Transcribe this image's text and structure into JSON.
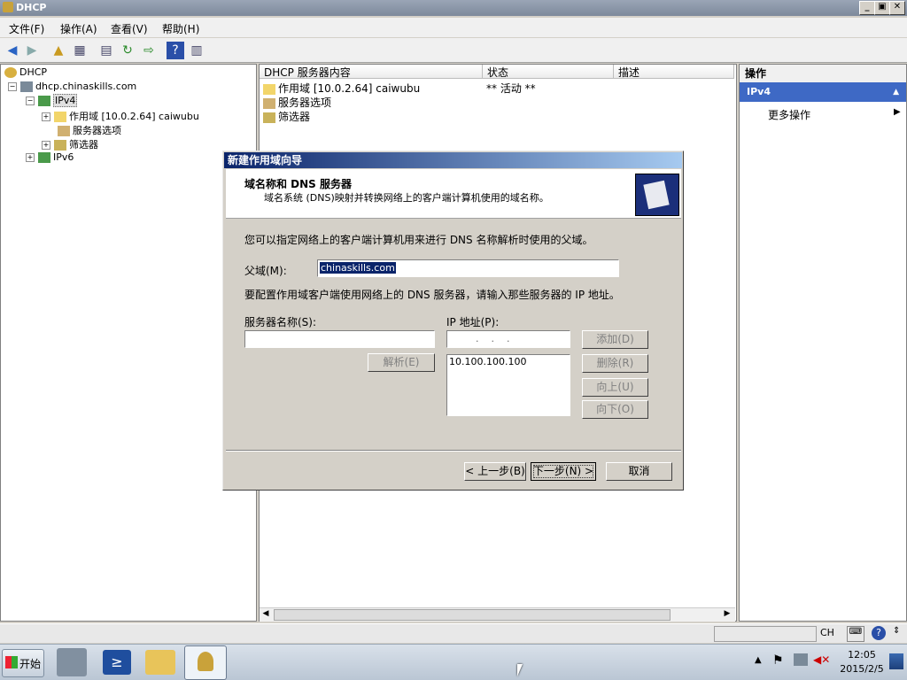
{
  "window": {
    "title": "DHCP",
    "min": "_",
    "max": "▣",
    "close": "✕"
  },
  "menu": [
    {
      "label": "文件(F)"
    },
    {
      "label": "操作(A)"
    },
    {
      "label": "查看(V)"
    },
    {
      "label": "帮助(H)"
    }
  ],
  "tree": {
    "root": "DHCP",
    "server": "dhcp.chinaskills.com",
    "ipv4": "IPv4",
    "scope": "作用域 [10.0.2.64] caiwubu",
    "server_options": "服务器选项",
    "filters": "筛选器",
    "ipv6": "IPv6"
  },
  "content": {
    "columns": [
      "DHCP 服务器内容",
      "状态",
      "描述"
    ],
    "rows": [
      {
        "name": "作用域 [10.0.2.64] caiwubu",
        "status": "** 活动 **"
      },
      {
        "name": "服务器选项",
        "status": ""
      },
      {
        "name": "筛选器",
        "status": ""
      }
    ]
  },
  "actions": {
    "title": "操作",
    "selected": "IPv4",
    "more": "更多操作"
  },
  "dialog": {
    "title": "新建作用域向导",
    "header_title": "域名称和 DNS 服务器",
    "header_sub": "域名系统 (DNS)映射并转换网络上的客户端计算机使用的域名称。",
    "intro": "您可以指定网络上的客户端计算机用来进行 DNS 名称解析时使用的父域。",
    "parent_label": "父域(M):",
    "parent_value": "chinaskills.com",
    "config_text": "要配置作用域客户端使用网络上的 DNS 服务器，请输入那些服务器的 IP 地址。",
    "server_name_label": "服务器名称(S):",
    "ip_label": "IP 地址(P):",
    "ip_dots": ".    .    .",
    "resolve": "解析(E)",
    "add": "添加(D)",
    "remove": "删除(R)",
    "up": "向上(U)",
    "down": "向下(O)",
    "ip_list": [
      "10.100.100.100"
    ],
    "back": "< 上一步(B)",
    "next": "下一步(N) >",
    "cancel": "取消"
  },
  "statusbar": {
    "ch": "CH"
  },
  "taskbar": {
    "start": "开始",
    "time": "12:05",
    "date": "2015/2/5"
  }
}
